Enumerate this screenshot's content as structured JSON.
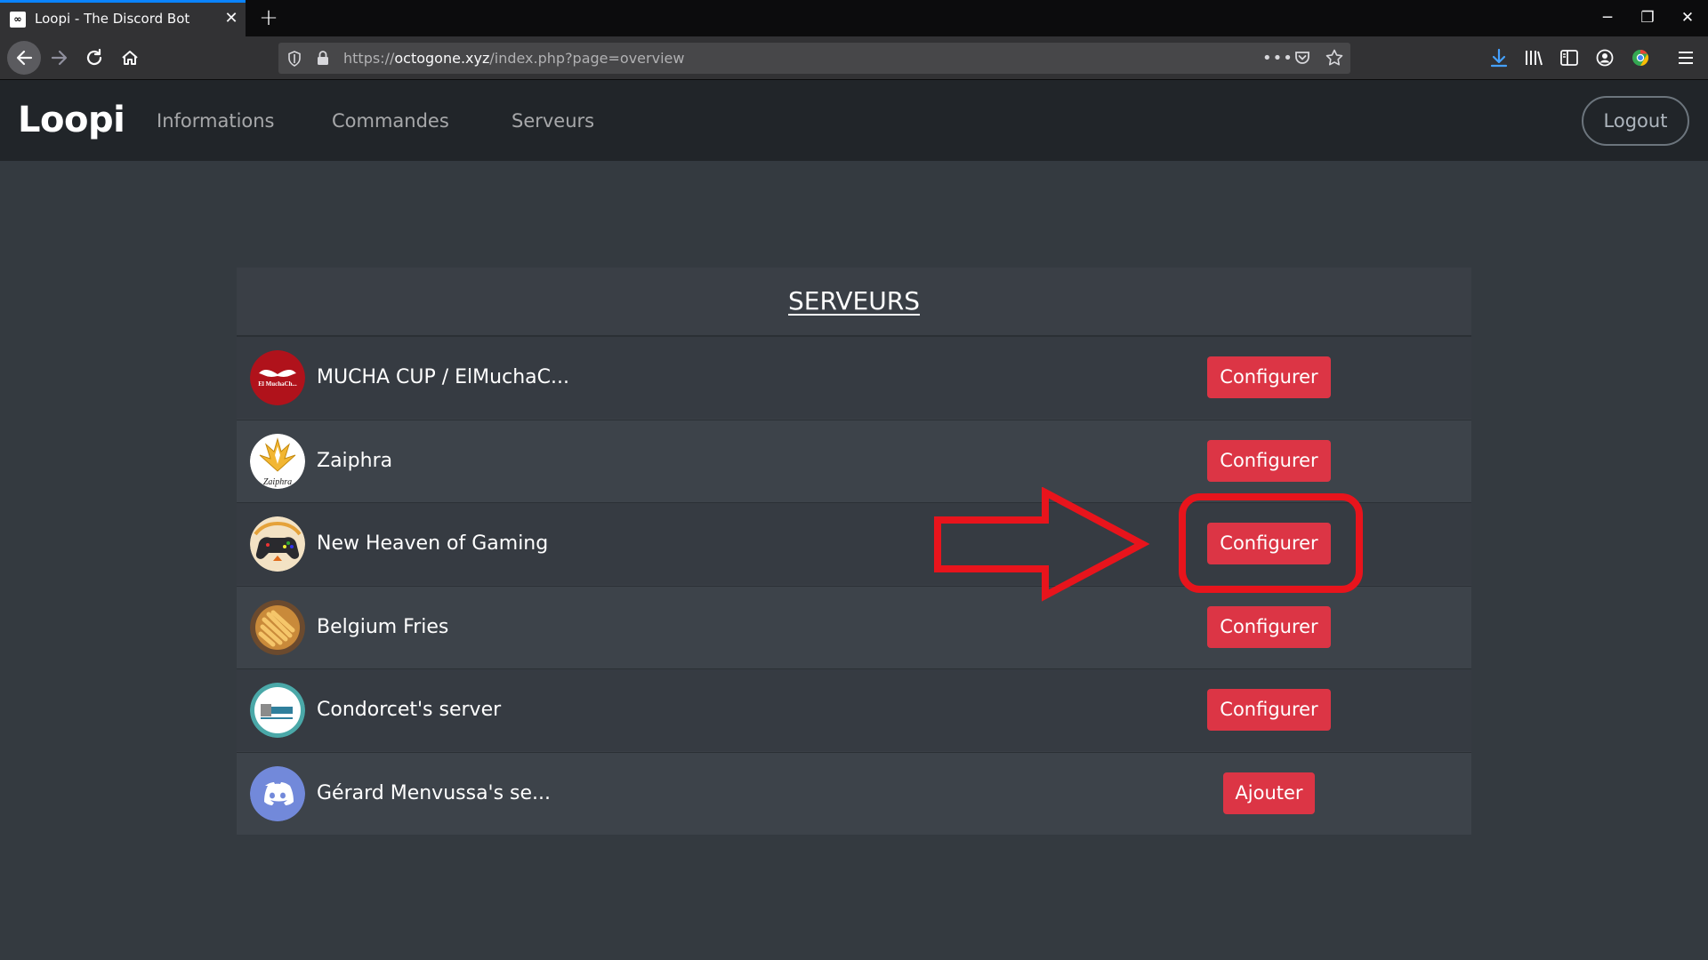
{
  "browser": {
    "tab_title": "Loopi - The Discord Bot",
    "tab_favicon": "∞",
    "url_scheme": "https://",
    "url_host": "octogone.xyz",
    "url_path": "/index.php?page=overview",
    "page_actions_icon": "•••"
  },
  "site": {
    "brand": "Loopi",
    "nav": [
      "Informations",
      "Commandes",
      "Serveurs"
    ],
    "logout_label": "Logout"
  },
  "servers": {
    "title": "SERVEURS",
    "rows": [
      {
        "name": "MUCHA CUP / ElMuchaC...",
        "action": "Configurer",
        "avatar_text": "El MuchaCh..."
      },
      {
        "name": "Zaiphra",
        "action": "Configurer",
        "avatar_text": "Zaiphra"
      },
      {
        "name": "New Heaven of Gaming",
        "action": "Configurer"
      },
      {
        "name": "Belgium Fries",
        "action": "Configurer"
      },
      {
        "name": "Condorcet's server",
        "action": "Configurer"
      },
      {
        "name": "Gérard Menvussa's se...",
        "action": "Ajouter"
      }
    ]
  },
  "colors": {
    "accent_red": "#dc3545",
    "annotation_red": "#e8141c",
    "page_bg": "#343a40",
    "header_bg": "#212529",
    "discord_blurple": "#7289da"
  }
}
